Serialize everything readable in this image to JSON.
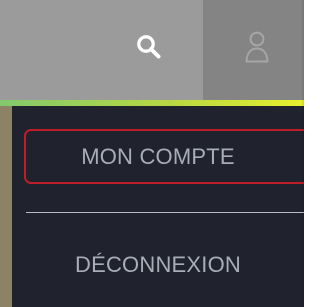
{
  "header": {
    "search_icon": "search-icon",
    "user_icon": "user-icon"
  },
  "menu": {
    "items": [
      {
        "label": "MON COMPTE"
      },
      {
        "label": "DÉCONNEXION"
      }
    ]
  },
  "colors": {
    "header_gray": "#9b9b9b",
    "user_button_gray": "#848484",
    "menu_background": "#20222e",
    "menu_text": "#a9adb6",
    "highlight_border": "#bf1d2a",
    "accent_start": "#83c86c",
    "accent_end": "#e6ef2d"
  }
}
